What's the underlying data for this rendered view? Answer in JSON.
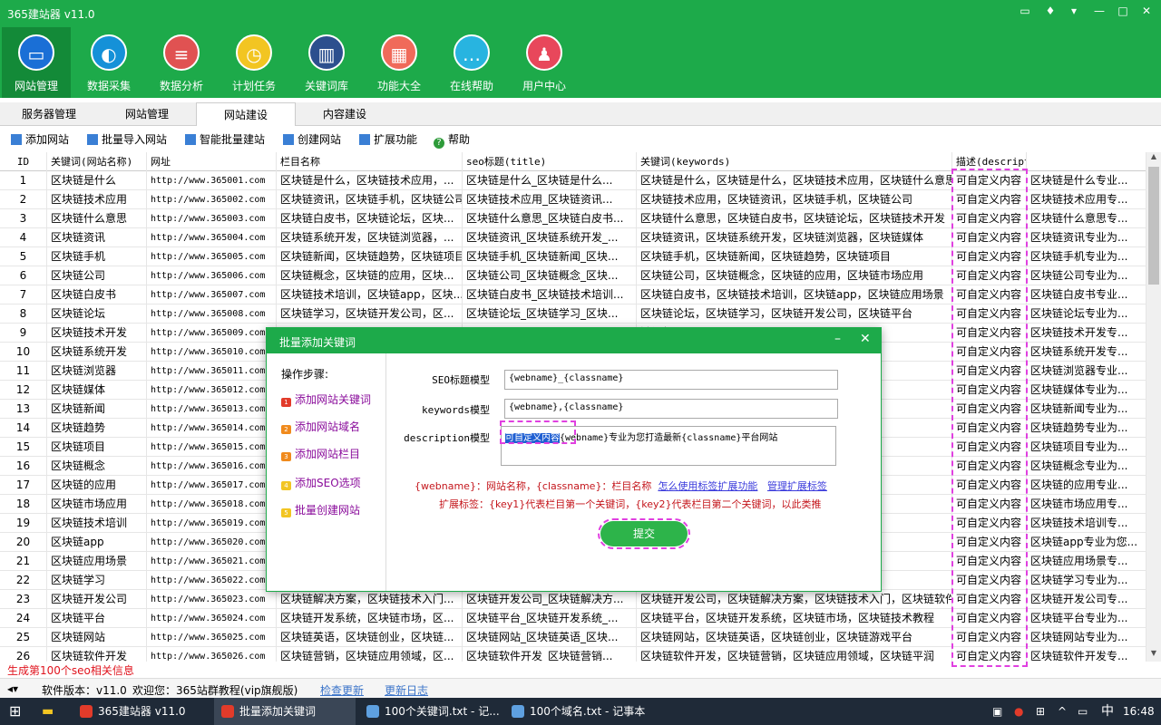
{
  "app": {
    "title": "365建站器 v11.0"
  },
  "ribbon": [
    {
      "label": "网站管理",
      "icon": "monitor-icon",
      "color": "#1a6fd6"
    },
    {
      "label": "数据采集",
      "icon": "edge-globe-icon",
      "color": "#1591d8"
    },
    {
      "label": "数据分析",
      "icon": "database-icon",
      "color": "#e05252"
    },
    {
      "label": "计划任务",
      "icon": "clock-icon",
      "color": "#f2c522"
    },
    {
      "label": "关键词库",
      "icon": "book-icon",
      "color": "#2c4f8e"
    },
    {
      "label": "功能大全",
      "icon": "grid-icon",
      "color": "#f06a5a"
    },
    {
      "label": "在线帮助",
      "icon": "chat-icon",
      "color": "#28b4e0"
    },
    {
      "label": "用户中心",
      "icon": "user-icon",
      "color": "#e8475b"
    }
  ],
  "tabs": [
    "服务器管理",
    "网站管理",
    "网站建设",
    "内容建设"
  ],
  "toolbar": [
    "添加网站",
    "批量导入网站",
    "智能批量建站",
    "创建网站",
    "扩展功能",
    "帮助"
  ],
  "table": {
    "headers": [
      "ID",
      "关键词(网站名称)",
      "网址",
      "栏目名称",
      "seo标题(title)",
      "关键词(keywords)",
      "描述(description)",
      ""
    ],
    "rows": [
      [
        "1",
        "区块链是什么",
        "http://www.365001.com",
        "区块链是什么，区块链技术应用，...",
        "区块链是什么_区块链是什么...",
        "区块链是什么，区块链是什么，区块链技术应用，区块链什么意思",
        "可自定义内容",
        "区块链是什么专业..."
      ],
      [
        "2",
        "区块链技术应用",
        "http://www.365002.com",
        "区块链资讯，区块链手机，区块链公司",
        "区块链技术应用_区块链资讯...",
        "区块链技术应用，区块链资讯，区块链手机，区块链公司",
        "可自定义内容",
        "区块链技术应用专..."
      ],
      [
        "3",
        "区块链什么意思",
        "http://www.365003.com",
        "区块链白皮书，区块链论坛，区块...",
        "区块链什么意思_区块链白皮书...",
        "区块链什么意思，区块链白皮书，区块链论坛，区块链技术开发",
        "可自定义内容",
        "区块链什么意思专..."
      ],
      [
        "4",
        "区块链资讯",
        "http://www.365004.com",
        "区块链系统开发，区块链浏览器，...",
        "区块链资讯_区块链系统开发_...",
        "区块链资讯，区块链系统开发，区块链浏览器，区块链媒体",
        "可自定义内容",
        "区块链资讯专业为..."
      ],
      [
        "5",
        "区块链手机",
        "http://www.365005.com",
        "区块链新闻，区块链趋势，区块链项目",
        "区块链手机_区块链新闻_区块...",
        "区块链手机，区块链新闻，区块链趋势，区块链项目",
        "可自定义内容",
        "区块链手机专业为..."
      ],
      [
        "6",
        "区块链公司",
        "http://www.365006.com",
        "区块链概念，区块链的应用，区块...",
        "区块链公司_区块链概念_区块...",
        "区块链公司，区块链概念，区块链的应用，区块链市场应用",
        "可自定义内容",
        "区块链公司专业为..."
      ],
      [
        "7",
        "区块链白皮书",
        "http://www.365007.com",
        "区块链技术培训，区块链app，区块...",
        "区块链白皮书_区块链技术培训...",
        "区块链白皮书，区块链技术培训，区块链app，区块链应用场景",
        "可自定义内容",
        "区块链白皮书专业..."
      ],
      [
        "8",
        "区块链论坛",
        "http://www.365008.com",
        "区块链学习，区块链开发公司，区...",
        "区块链论坛_区块链学习_区块...",
        "区块链论坛，区块链学习，区块链开发公司，区块链平台",
        "可自定义内容",
        "区块链论坛专业为..."
      ],
      [
        "9",
        "区块链技术开发",
        "http://www.365009.com",
        "",
        "",
        "链视频",
        "可自定义内容",
        "区块链技术开发专..."
      ],
      [
        "10",
        "区块链系统开发",
        "http://www.365010.com",
        "",
        "",
        "文",
        "可自定义内容",
        "区块链系统开发专..."
      ],
      [
        "11",
        "区块链浏览器",
        "http://www.365011.com",
        "",
        "",
        "培训",
        "可自定义内容",
        "区块链浏览器专业..."
      ],
      [
        "12",
        "区块链媒体",
        "http://www.365012.com",
        "",
        "",
        "技术原理",
        "可自定义内容",
        "区块链媒体专业为..."
      ],
      [
        "13",
        "区块链新闻",
        "http://www.365013.com",
        "",
        "",
        "习",
        "可自定义内容",
        "区块链新闻专业为..."
      ],
      [
        "14",
        "区块链趋势",
        "http://www.365014.com",
        "",
        "",
        "源",
        "可自定义内容",
        "区块链趋势专业为..."
      ],
      [
        "15",
        "区块链项目",
        "http://www.365015.com",
        "",
        "",
        "发",
        "可自定义内容",
        "区块链项目专业为..."
      ],
      [
        "16",
        "区块链概念",
        "http://www.365016.com",
        "",
        "",
        "链技术指南",
        "可自定义内容",
        "区块链概念专业为..."
      ],
      [
        "17",
        "区块链的应用",
        "http://www.365017.com",
        "",
        "",
        "有什么用",
        "可自定义内容",
        "区块链的应用专业..."
      ],
      [
        "18",
        "区块链市场应用",
        "http://www.365018.com",
        "",
        "",
        "链底层技术",
        "可自定义内容",
        "区块链市场应用专..."
      ],
      [
        "19",
        "区块链技术培训",
        "http://www.365019.com",
        "",
        "",
        "链教育",
        "可自定义内容",
        "区块链技术培训专..."
      ],
      [
        "20",
        "区块链app",
        "http://www.365020.com",
        "",
        "",
        "发平台",
        "可自定义内容",
        "区块链app专业为您..."
      ],
      [
        "21",
        "区块链应用场景",
        "http://www.365021.com",
        "",
        "",
        "链产业",
        "可自定义内容",
        "区块链应用场景专..."
      ],
      [
        "22",
        "区块链学习",
        "http://www.365022.com",
        "",
        "",
        "台",
        "可自定义内容",
        "区块链学习专业为..."
      ],
      [
        "23",
        "区块链开发公司",
        "http://www.365023.com",
        "区块链解决方案，区块链技术入门...",
        "区块链开发公司_区块链解决方...",
        "区块链开发公司，区块链解决方案，区块链技术入门，区块链软件",
        "可自定义内容",
        "区块链开发公司专..."
      ],
      [
        "24",
        "区块链平台",
        "http://www.365024.com",
        "区块链开发系统，区块链市场，区...",
        "区块链平台_区块链开发系统_...",
        "区块链平台，区块链开发系统，区块链市场，区块链技术教程",
        "可自定义内容",
        "区块链平台专业为..."
      ],
      [
        "25",
        "区块链网站",
        "http://www.365025.com",
        "区块链英语，区块链创业，区块链...",
        "区块链网站_区块链英语_区块...",
        "区块链网站，区块链英语，区块链创业，区块链游戏平台",
        "可自定义内容",
        "区块链网站专业为..."
      ],
      [
        "26",
        "区块链软件开发",
        "http://www.365026.com",
        "区块链营销，区块链应用领域，区...",
        "区块链软件开发_区块链营销...",
        "区块链软件开发，区块链营销，区块链应用领域，区块链平润",
        "可自定义内容",
        "区块链软件开发专..."
      ]
    ]
  },
  "status": {
    "red_msg": "生成第100个seo相关信息",
    "version": "软件版本：v11.0",
    "welcome": "欢迎您：365站群教程(vip旗舰版)",
    "check_update": "检查更新",
    "update_log": "更新日志"
  },
  "dialog": {
    "title": "批量添加关键词",
    "steps_title": "操作步骤:",
    "steps": [
      "添加网站关键词",
      "添加网站域名",
      "添加网站栏目",
      "添加SEO选项",
      "批量创建网站"
    ],
    "step_colors": [
      "#e23b2a",
      "#f08a1c",
      "#f08a1c",
      "#f2c522",
      "#f2c522"
    ],
    "seo_label": "SEO标题模型",
    "seo_value": "{webname}_{classname}",
    "kw_label": "keywords模型",
    "kw_value": "{webname},{classname}",
    "desc_label": "description模型",
    "desc_selected": "可自定义内容",
    "desc_rest": "{webname}专业为您打造最新{classname}平台网站",
    "hint_a": "{webname}：网站名称，{classname}：栏目名称",
    "hint_link1": "怎么使用标签扩展功能",
    "hint_link2": "管理扩展标签",
    "hint2": "扩展标签：{key1}代表栏目第一个关键词，{key2}代表栏目第二个关键词，以此类推",
    "submit": "提交"
  },
  "taskbar": {
    "items": [
      "365建站器 v11.0",
      "批量添加关键词",
      "100个关键词.txt - 记...",
      "100个域名.txt - 记事本"
    ],
    "ime": "中",
    "time": "16:48"
  }
}
